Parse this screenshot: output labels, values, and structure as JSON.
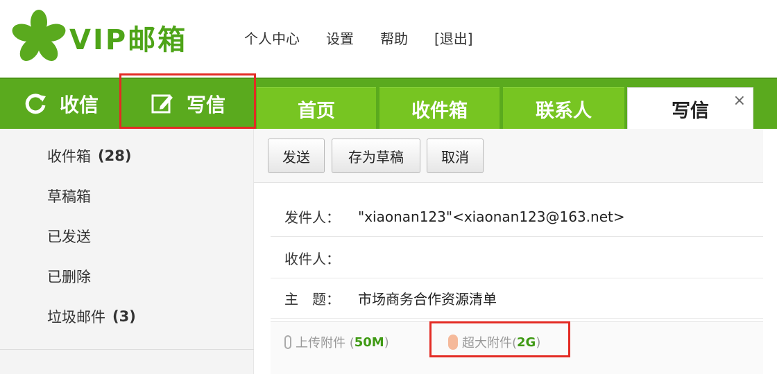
{
  "app": {
    "logo_text": "VIP邮箱",
    "top_links": [
      "个人中心",
      "设置",
      "帮助",
      "[退出]"
    ]
  },
  "nav": {
    "receive_label": "收信",
    "write_label": "写信"
  },
  "tabs": [
    {
      "label": "首页"
    },
    {
      "label": "收件箱"
    },
    {
      "label": "联系人"
    },
    {
      "label": "写信",
      "close": "×"
    }
  ],
  "sidebar": {
    "folders": [
      {
        "label": "收件箱",
        "count": "(28)"
      },
      {
        "label": "草稿箱",
        "count": ""
      },
      {
        "label": "已发送",
        "count": ""
      },
      {
        "label": "已删除",
        "count": ""
      },
      {
        "label": "垃圾邮件",
        "count": "(3)"
      }
    ]
  },
  "toolbar": {
    "send_label": "发送",
    "draft_label": "存为草稿",
    "cancel_label": "取消"
  },
  "compose": {
    "from_label": "发件人：",
    "from_value": "\"xiaonan123\"<xiaonan123@163.net>",
    "to_label": "收件人：",
    "to_value": "",
    "subject_label": "主　题：",
    "subject_value": "市场商务合作资源清单",
    "attach_upload_label": "上传附件 (",
    "attach_upload_size": "50M",
    "attach_upload_end": ")",
    "attach_large_label": "超大附件(",
    "attach_large_size": "2G",
    "attach_large_end": ")"
  },
  "colors": {
    "brand_green": "#5aaa1e",
    "tab_green": "#77c522",
    "highlight_red": "#e32b24"
  },
  "icons": {
    "logo": "clover-logo-icon",
    "receive": "refresh-icon",
    "write": "edit-icon"
  }
}
